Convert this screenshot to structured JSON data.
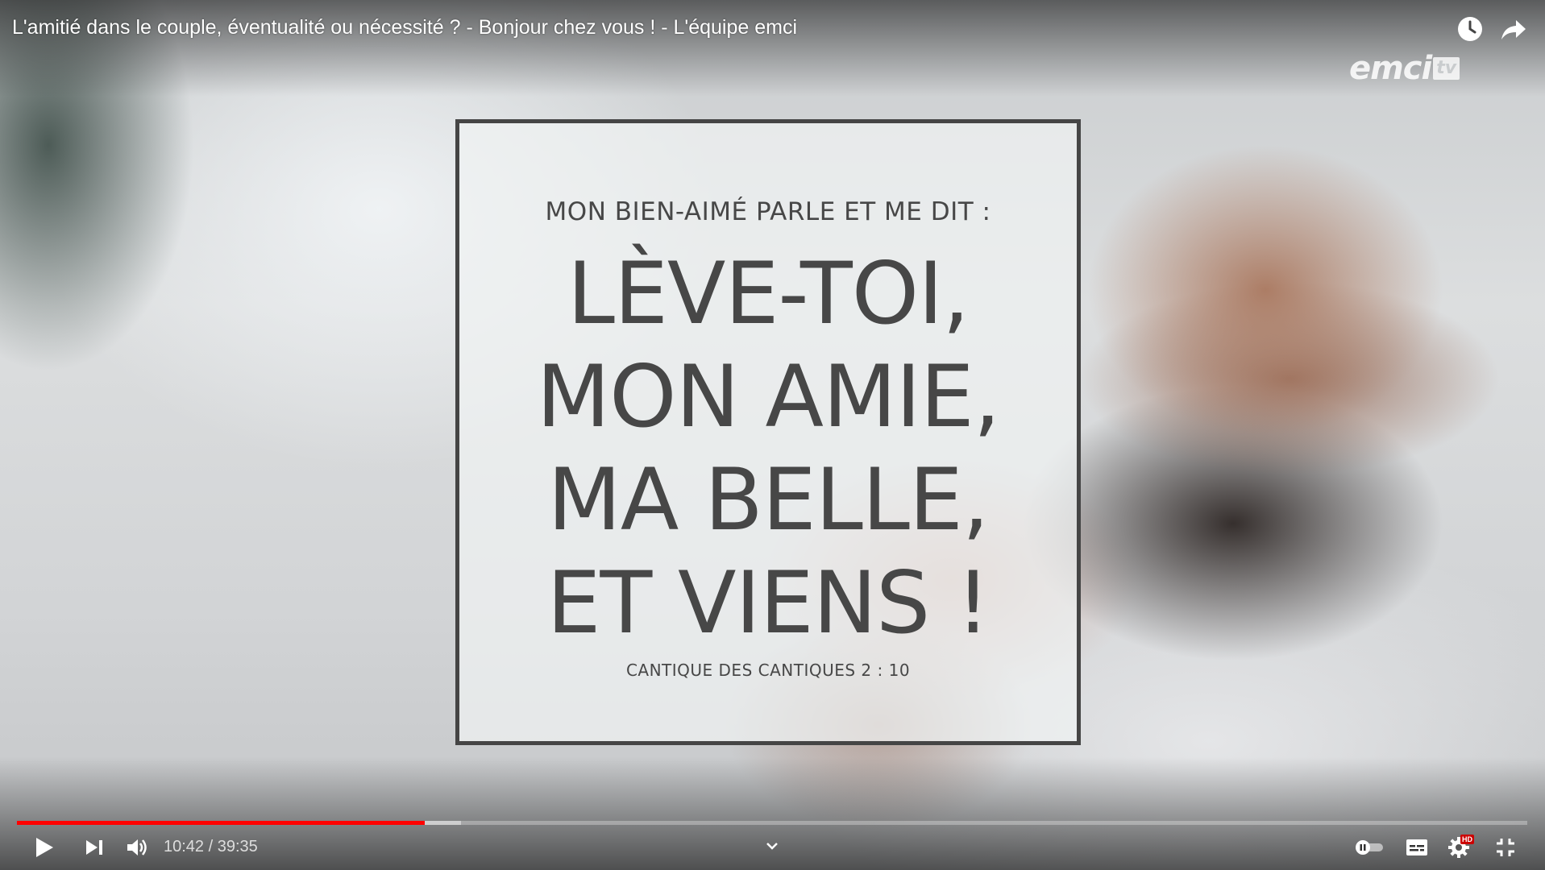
{
  "video": {
    "title": "L'amitié dans le couple, éventualité ou nécessité ? - Bonjour chez vous ! - L'équipe emci"
  },
  "top_controls": {
    "watch_later_icon": "clock-icon",
    "share_icon": "share-arrow-icon"
  },
  "channel_logo": {
    "main": "emci",
    "suffix": "tv"
  },
  "quote": {
    "intro": "MON BIEN-AIMÉ PARLE ET ME DIT :",
    "lines": [
      "LÈVE-TOI,",
      "MON AMIE,",
      "MA BELLE,",
      "ET VIENS !"
    ],
    "reference": "CANTIQUE DES CANTIQUES 2 : 10"
  },
  "player": {
    "current_time": "10:42",
    "duration": "39:35",
    "time_display": "10:42 / 39:35",
    "progress_fraction": 0.27,
    "buffered_fraction": 0.294,
    "hd_badge": "HD",
    "colors": {
      "progress": "#ff0000",
      "hd_badge": "#cc0000"
    },
    "icons": {
      "play": "play-icon",
      "next": "next-icon",
      "volume": "volume-icon",
      "chapters": "chevron-down-icon",
      "autoplay": "autoplay-toggle-icon",
      "subtitles": "subtitles-icon",
      "settings": "gear-icon",
      "fullscreen_exit": "fullscreen-exit-icon"
    }
  }
}
